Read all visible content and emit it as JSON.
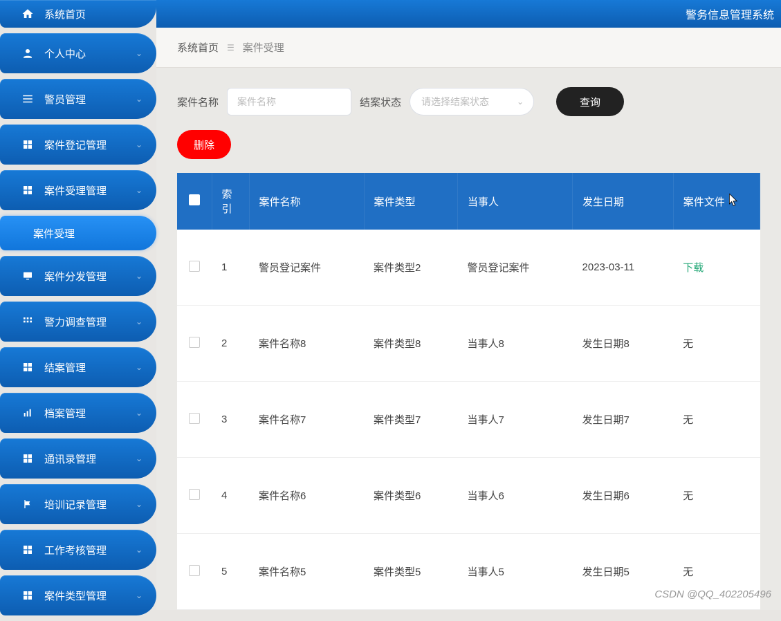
{
  "header": {
    "system_title": "警务信息管理系统"
  },
  "breadcrumb": {
    "home": "系统首页",
    "current": "案件受理"
  },
  "sidebar": {
    "items": [
      {
        "icon": "home-icon",
        "label": "系统首页",
        "has_chevron": false
      },
      {
        "icon": "person-icon",
        "label": "个人中心",
        "has_chevron": true
      },
      {
        "icon": "list-icon",
        "label": "警员管理",
        "has_chevron": true
      },
      {
        "icon": "grid-icon",
        "label": "案件登记管理",
        "has_chevron": true
      },
      {
        "icon": "grid-icon",
        "label": "案件受理管理",
        "has_chevron": true
      },
      {
        "icon": "monitor-icon",
        "label": "案件分发管理",
        "has_chevron": true
      },
      {
        "icon": "grid4-icon",
        "label": "警力调查管理",
        "has_chevron": true
      },
      {
        "icon": "grid-icon",
        "label": "结案管理",
        "has_chevron": true
      },
      {
        "icon": "bars-icon",
        "label": "档案管理",
        "has_chevron": true
      },
      {
        "icon": "grid-icon",
        "label": "通讯录管理",
        "has_chevron": true
      },
      {
        "icon": "flag-icon",
        "label": "培训记录管理",
        "has_chevron": true
      },
      {
        "icon": "grid-icon",
        "label": "工作考核管理",
        "has_chevron": true
      },
      {
        "icon": "grid-icon",
        "label": "案件类型管理",
        "has_chevron": true
      }
    ],
    "subitem_label": "案件受理"
  },
  "filters": {
    "name_label": "案件名称",
    "name_placeholder": "案件名称",
    "status_label": "结案状态",
    "status_placeholder": "请选择结案状态",
    "query_button": "查询",
    "delete_button": "删除"
  },
  "table": {
    "columns": [
      "索引",
      "案件名称",
      "案件类型",
      "当事人",
      "发生日期",
      "案件文件"
    ],
    "rows": [
      {
        "index": "1",
        "name": "警员登记案件",
        "type": "案件类型2",
        "party": "警员登记案件",
        "date": "2023-03-11",
        "file": "下载",
        "file_is_link": true
      },
      {
        "index": "2",
        "name": "案件名称8",
        "type": "案件类型8",
        "party": "当事人8",
        "date": "发生日期8",
        "file": "无",
        "file_is_link": false
      },
      {
        "index": "3",
        "name": "案件名称7",
        "type": "案件类型7",
        "party": "当事人7",
        "date": "发生日期7",
        "file": "无",
        "file_is_link": false
      },
      {
        "index": "4",
        "name": "案件名称6",
        "type": "案件类型6",
        "party": "当事人6",
        "date": "发生日期6",
        "file": "无",
        "file_is_link": false
      },
      {
        "index": "5",
        "name": "案件名称5",
        "type": "案件类型5",
        "party": "当事人5",
        "date": "发生日期5",
        "file": "无",
        "file_is_link": false
      }
    ]
  },
  "watermark": "CSDN @QQ_402205496"
}
